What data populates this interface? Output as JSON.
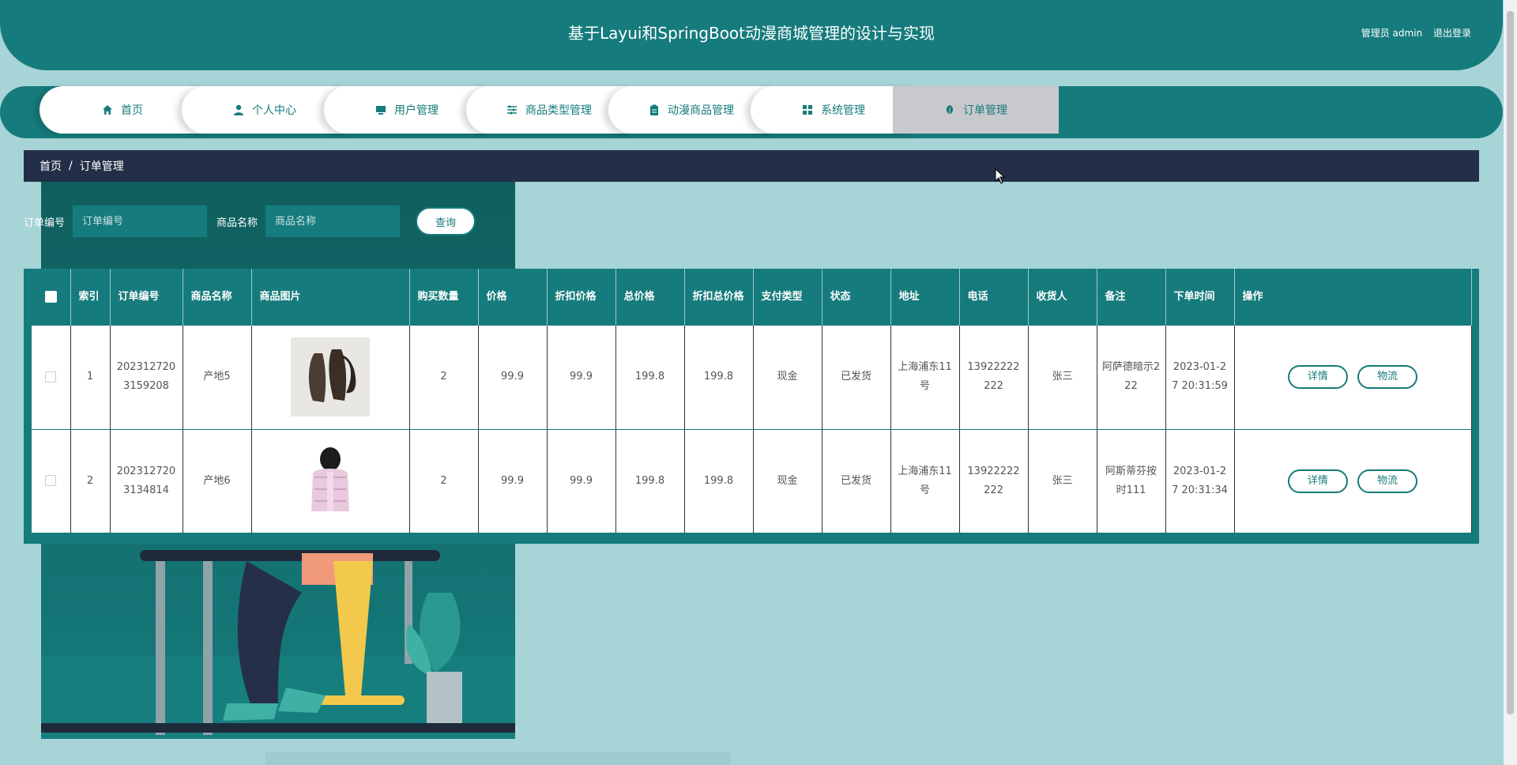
{
  "header": {
    "title": "基于Layui和SpringBoot动漫商城管理的设计与实现",
    "role_user": "管理员 admin",
    "logout": "退出登录"
  },
  "nav": {
    "items": [
      {
        "label": "首页",
        "icon": "home-icon"
      },
      {
        "label": "个人中心",
        "icon": "user-icon"
      },
      {
        "label": "用户管理",
        "icon": "monitor-icon"
      },
      {
        "label": "商品类型管理",
        "icon": "sliders-icon"
      },
      {
        "label": "动漫商品管理",
        "icon": "clipboard-icon"
      },
      {
        "label": "系统管理",
        "icon": "grid-icon"
      },
      {
        "label": "订单管理",
        "icon": "leaf-icon"
      }
    ],
    "active_index": 6
  },
  "breadcrumb": {
    "home": "首页",
    "sep": "/",
    "current": "订单管理"
  },
  "search": {
    "order_no_label": "订单编号",
    "order_no_placeholder": "订单编号",
    "product_label": "商品名称",
    "product_placeholder": "商品名称",
    "query_button": "查询"
  },
  "table": {
    "headers": [
      "索引",
      "订单编号",
      "商品名称",
      "商品图片",
      "购买数量",
      "价格",
      "折扣价格",
      "总价格",
      "折扣总价格",
      "支付类型",
      "状态",
      "地址",
      "电话",
      "收货人",
      "备注",
      "下单时间",
      "操作"
    ],
    "rows": [
      {
        "index": "1",
        "order_no": "2023127203159208",
        "product": "产地5",
        "image": "product-image-gloves",
        "qty": "2",
        "price": "99.9",
        "discount_price": "99.9",
        "total": "199.8",
        "discount_total": "199.8",
        "pay_type": "现金",
        "status": "已发货",
        "address": "上海浦东11号",
        "phone": "13922222222",
        "receiver": "张三",
        "remark": "阿萨德暗示222",
        "time": "2023-01-27 20:31:59",
        "detail": "详情",
        "logistics": "物流"
      },
      {
        "index": "2",
        "order_no": "2023127203134814",
        "product": "产地6",
        "image": "product-image-vest",
        "qty": "2",
        "price": "99.9",
        "discount_price": "99.9",
        "total": "199.8",
        "discount_total": "199.8",
        "pay_type": "现金",
        "status": "已发货",
        "address": "上海浦东11号",
        "phone": "13922222222",
        "receiver": "张三",
        "remark": "阿斯蒂芬按时111",
        "time": "2023-01-27 20:31:34",
        "detail": "详情",
        "logistics": "物流"
      }
    ]
  },
  "colors": {
    "primary": "#167b7c",
    "breadcrumb_bg": "#232f48",
    "page_bg": "#a7d4d6"
  }
}
